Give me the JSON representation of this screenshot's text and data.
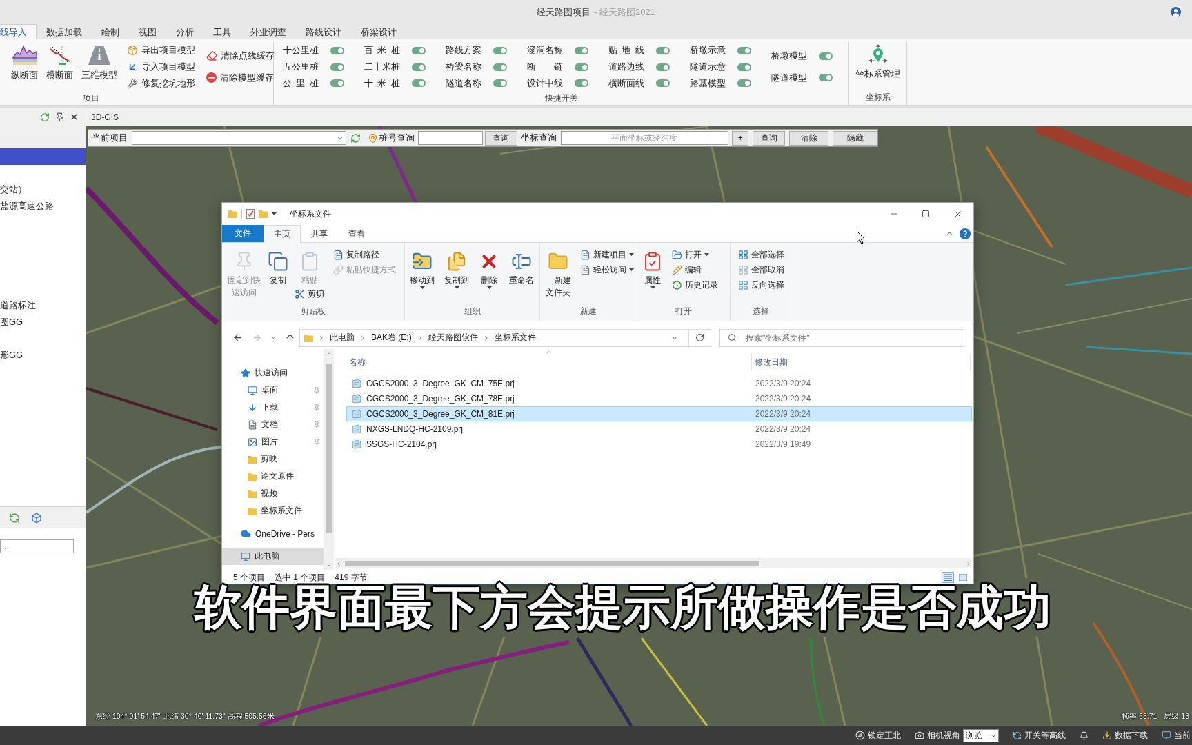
{
  "title_bar": {
    "app_title": "经天路图项目",
    "app_name": "- 经天路图2021"
  },
  "ribbon_tabs": [
    {
      "label": "线导入",
      "selected": true
    },
    {
      "label": "数据加载",
      "selected": false
    },
    {
      "label": "绘制",
      "selected": false
    },
    {
      "label": "视图",
      "selected": false
    },
    {
      "label": "分析",
      "selected": false
    },
    {
      "label": "工具",
      "selected": false
    },
    {
      "label": "外业调查",
      "selected": false
    },
    {
      "label": "路线设计",
      "selected": false
    },
    {
      "label": "桥梁设计",
      "selected": false
    }
  ],
  "ribbon": {
    "project_group": {
      "label": "项目",
      "large_buttons": [
        "纵断面",
        "横断面",
        "三维模型"
      ],
      "small_columns": [
        [
          "导出项目模型",
          "导入项目模型",
          "修复挖坑地形"
        ],
        [
          "清除点线缓存",
          "清除模型缓存"
        ]
      ]
    },
    "switch_group": {
      "label": "快捷开关",
      "columns": [
        [
          {
            "label": "十公里桩",
            "on": true
          },
          {
            "label": "五公里桩",
            "on": true
          },
          {
            "label": "公 里 桩",
            "on": true
          }
        ],
        [
          {
            "label": "百 米 桩",
            "on": true
          },
          {
            "label": "二十米桩",
            "on": true
          },
          {
            "label": "十 米 桩",
            "on": true
          }
        ],
        [
          {
            "label": "路线方案",
            "on": true
          },
          {
            "label": "桥梁名称",
            "on": true
          },
          {
            "label": "隧道名称",
            "on": true
          }
        ],
        [
          {
            "label": "涵洞名称",
            "on": true
          },
          {
            "label": "断　链",
            "on": true
          },
          {
            "label": "设计中线",
            "on": true
          }
        ],
        [
          {
            "label": "贴 地 线",
            "on": true
          },
          {
            "label": "道路边线",
            "on": true
          },
          {
            "label": "横断面线",
            "on": true
          }
        ],
        [
          {
            "label": "桥墩示意",
            "on": true
          },
          {
            "label": "隧道示意",
            "on": true
          },
          {
            "label": "路基模型",
            "on": true
          }
        ],
        [
          {
            "label": "桥墩模型",
            "on": true
          },
          {
            "label": "隧道模型",
            "on": true
          }
        ]
      ]
    },
    "coordinate_group": {
      "label": "坐标系",
      "button": "坐标系管理"
    }
  },
  "left_panel": {
    "tree": [
      {
        "selected": true
      },
      {
        "label": "交站）",
        "selected": false
      },
      {
        "label": "盐源高速公路",
        "selected": false
      },
      {
        "label": "道路标注",
        "selected": false
      },
      {
        "label": "图GG",
        "selected": false
      },
      {
        "label": "形GG",
        "selected": false
      }
    ],
    "search": {
      "placeholder": "..."
    }
  },
  "document_tab": "3D-GIS",
  "query_bar": {
    "project_label": "当前项目",
    "stake_label": "桩号查询",
    "stake_button": "查询",
    "coordinate_label": "坐标查询",
    "coordinate_placeholder": "平面坐标或经纬度",
    "add_button": "+",
    "buttons": [
      "查询",
      "清除",
      "隐藏"
    ]
  },
  "explorer": {
    "title": "坐标系文件",
    "tabs": [
      {
        "label": "文件",
        "kind": "file_menu",
        "selected": false
      },
      {
        "label": "主页",
        "kind": "tab",
        "selected": true
      },
      {
        "label": "共享",
        "kind": "tab",
        "selected": false
      },
      {
        "label": "查看",
        "kind": "tab",
        "selected": false
      }
    ],
    "ribbon_groups": [
      {
        "label": "剪贴板",
        "columns": [
          [
            {
              "label": "固定到快速访问",
              "kind": "large",
              "disabled": true,
              "dropdown": false
            }
          ],
          [
            {
              "label": "复制",
              "kind": "large",
              "disabled": false,
              "dropdown": false
            }
          ],
          [
            {
              "label": "粘贴",
              "kind": "large",
              "disabled": true,
              "dropdown": false
            },
            {
              "label": "剪切",
              "kind": "small",
              "disabled": false,
              "dropdown": false
            }
          ],
          [
            {
              "label": "复制路径",
              "kind": "small",
              "disabled": false,
              "dropdown": false
            },
            {
              "label": "粘贴快捷方式",
              "kind": "small",
              "disabled": true,
              "dropdown": false
            }
          ]
        ]
      },
      {
        "label": "组织",
        "columns": [
          [
            {
              "label": "移动到",
              "kind": "large",
              "disabled": false,
              "dropdown": true
            }
          ],
          [
            {
              "label": "复制到",
              "kind": "large",
              "disabled": false,
              "dropdown": true
            }
          ],
          [
            {
              "label": "删除",
              "kind": "large",
              "disabled": false,
              "dropdown": true
            }
          ],
          [
            {
              "label": "重命名",
              "kind": "large",
              "disabled": false,
              "dropdown": false
            }
          ]
        ]
      },
      {
        "label": "新建",
        "columns": [
          [
            {
              "label": "新建文件夹",
              "kind": "large",
              "disabled": false,
              "dropdown": false
            }
          ],
          [
            {
              "label": "新建项目",
              "kind": "small",
              "disabled": false,
              "dropdown": true
            },
            {
              "label": "轻松访问",
              "kind": "small",
              "disabled": false,
              "dropdown": true
            }
          ]
        ]
      },
      {
        "label": "打开",
        "columns": [
          [
            {
              "label": "属性",
              "kind": "large",
              "disabled": false,
              "dropdown": true
            }
          ],
          [
            {
              "label": "打开",
              "kind": "small",
              "disabled": false,
              "dropdown": true
            },
            {
              "label": "编辑",
              "kind": "small",
              "disabled": false,
              "dropdown": false
            },
            {
              "label": "历史记录",
              "kind": "small",
              "disabled": false,
              "dropdown": false
            }
          ]
        ]
      },
      {
        "label": "选择",
        "columns": [
          [
            {
              "label": "全部选择",
              "kind": "small",
              "disabled": false,
              "dropdown": false
            },
            {
              "label": "全部取消",
              "kind": "small",
              "disabled": false,
              "dropdown": false
            },
            {
              "label": "反向选择",
              "kind": "small",
              "disabled": false,
              "dropdown": false
            }
          ]
        ]
      }
    ],
    "path": [
      "此电脑",
      "BAK卷 (E:)",
      "经天路图软件",
      "坐标系文件"
    ],
    "search": {
      "placeholder": "搜索\"坐标系文件\""
    },
    "nav": [
      {
        "label": "快速访问",
        "kind": "quick_access",
        "selected": false,
        "children": [
          {
            "label": "桌面",
            "kind": "desktop",
            "pinned": true,
            "selected": false
          },
          {
            "label": "下载",
            "kind": "downloads",
            "pinned": true,
            "selected": false
          },
          {
            "label": "文档",
            "kind": "documents",
            "pinned": true,
            "selected": false
          },
          {
            "label": "图片",
            "kind": "pictures",
            "pinned": true,
            "selected": false
          },
          {
            "label": "剪映",
            "kind": "folder",
            "pinned": false,
            "selected": false
          },
          {
            "label": "论文原件",
            "kind": "folder",
            "pinned": false,
            "selected": false
          },
          {
            "label": "视频",
            "kind": "folder",
            "pinned": false,
            "selected": false
          },
          {
            "label": "坐标系文件",
            "kind": "folder",
            "pinned": false,
            "selected": false
          }
        ]
      },
      {
        "label": "OneDrive - Pers",
        "kind": "cloud",
        "selected": false
      },
      {
        "label": "此电脑",
        "kind": "computer",
        "selected": true
      }
    ],
    "columns": [
      "名称",
      "修改日期"
    ],
    "files": [
      {
        "name": "CGCS2000_3_Degree_GK_CM_75E.prj",
        "modified": "2022/3/9 20:24",
        "selected": false
      },
      {
        "name": "CGCS2000_3_Degree_GK_CM_78E.prj",
        "modified": "2022/3/9 20:24",
        "selected": false
      },
      {
        "name": "CGCS2000_3_Degree_GK_CM_81E.prj",
        "modified": "2022/3/9 20:24",
        "selected": true
      },
      {
        "name": "NXGS-LNDQ-HC-2109.prj",
        "modified": "2022/3/9 20:24",
        "selected": false
      },
      {
        "name": "SSGS-HC-2104.prj",
        "modified": "2022/3/9 19:49",
        "selected": false
      }
    ],
    "status": [
      "5 个项目",
      "选中 1 个项目",
      "419 字节"
    ]
  },
  "map_overlay": {
    "position": "东经 104° 01' 54.47\" 北纬 30° 40' 11.73\" 高程 505.56米",
    "frame_rate": "帧率 68.71",
    "level": "层级 13"
  },
  "status_bar": [
    {
      "label": "锁定正北",
      "kind": "compass"
    },
    {
      "label": "相机视角",
      "kind": "camera",
      "value": "浏览"
    },
    {
      "label": "开关等高线",
      "kind": "contour"
    },
    {
      "label": "数据下载",
      "kind": "download"
    },
    {
      "label": "当前",
      "kind": "screen"
    }
  ],
  "subtitle": "软件界面最下方会提示所做操作是否成功"
}
